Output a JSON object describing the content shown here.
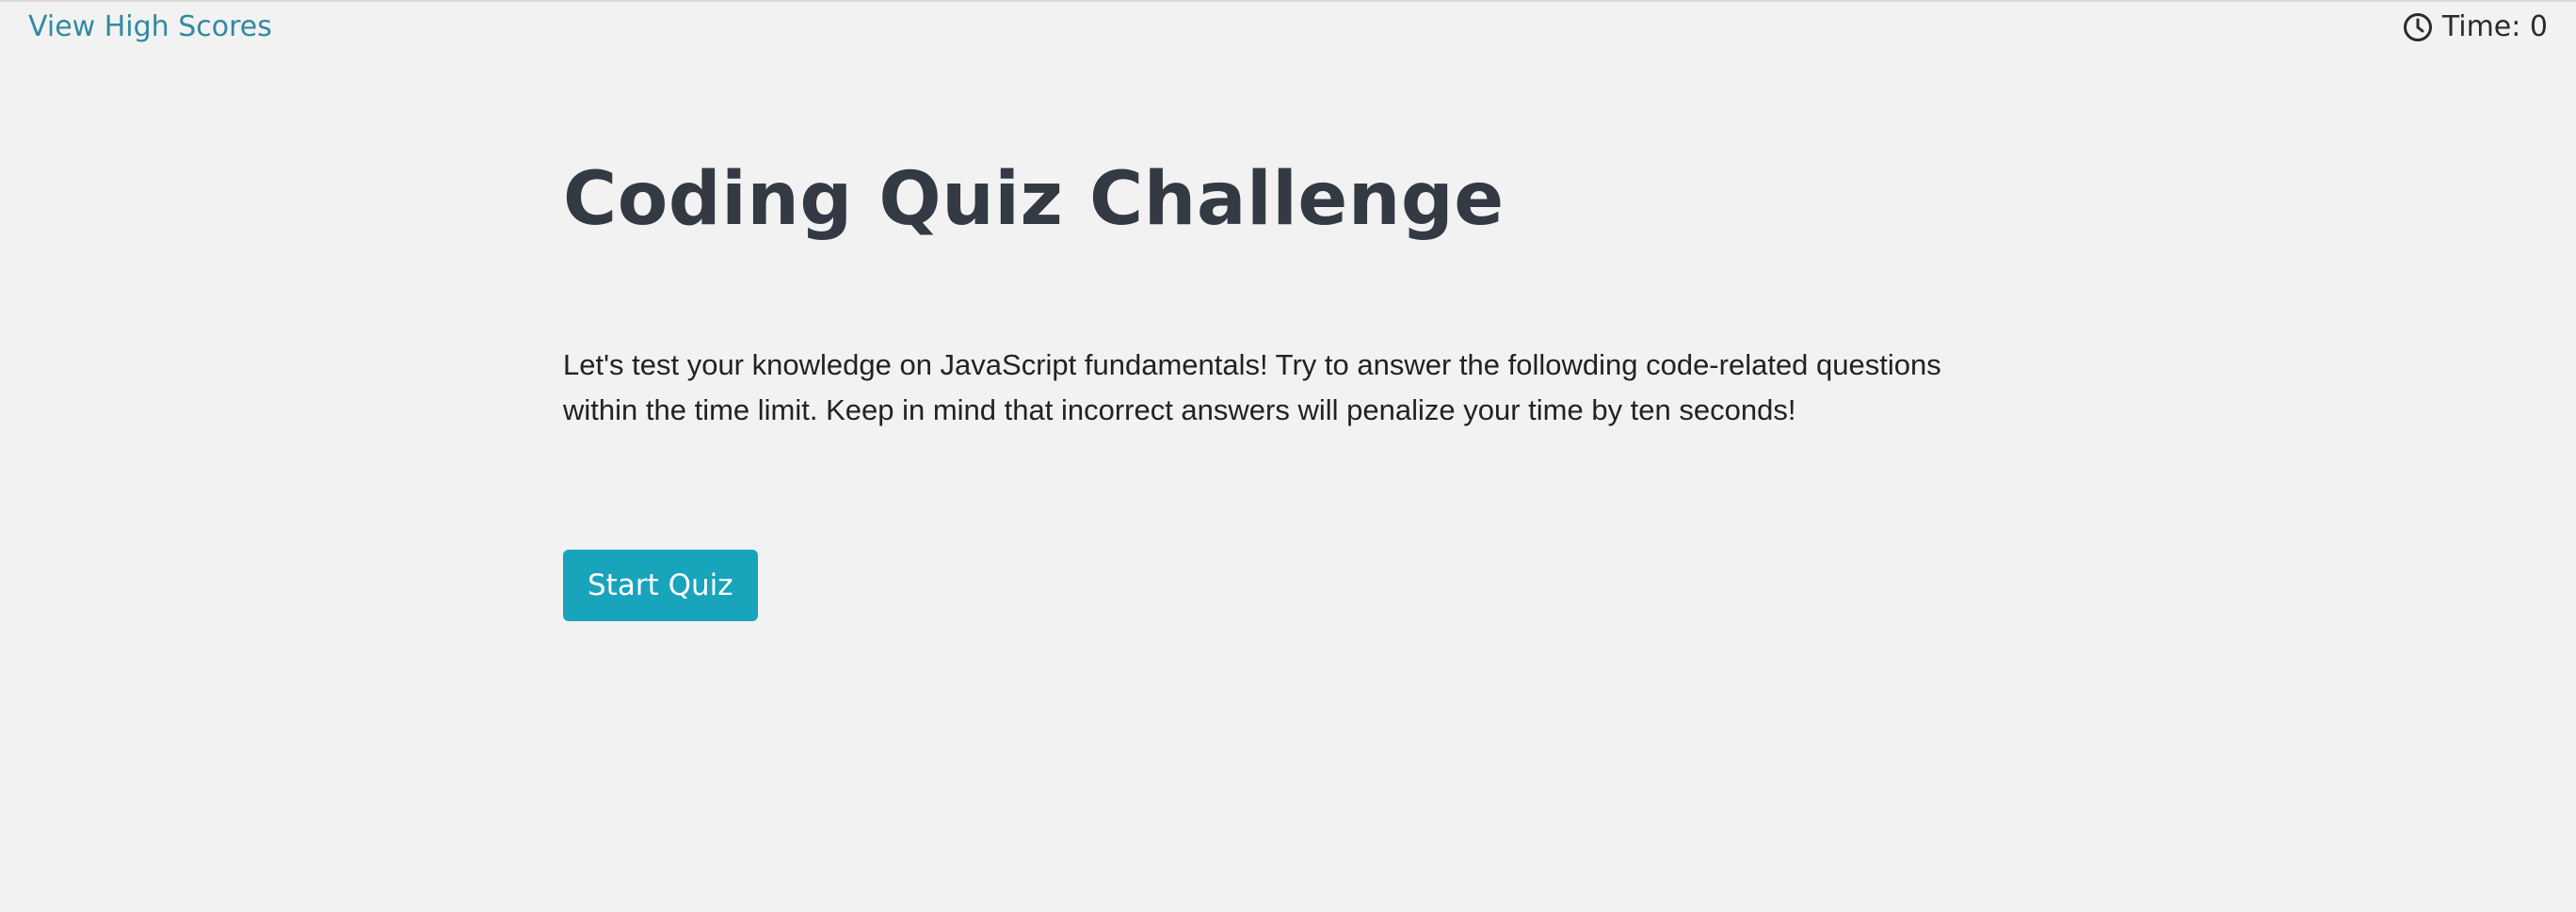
{
  "header": {
    "high_scores_link": "View High Scores",
    "timer": {
      "icon": "clock-icon",
      "text": "Time: 0"
    }
  },
  "main": {
    "title": "Coding Quiz Challenge",
    "intro": "Let's test your knowledge on JavaScript fundamentals! Try to answer the followding code-related questions within the time limit. Keep in mind that incorrect answers will penalize your time by ten seconds!",
    "start_button": "Start Quiz"
  },
  "colors": {
    "background": "#f2f2f2",
    "link": "#2f8aa3",
    "title": "#333a44",
    "button": "#18a4bb"
  }
}
